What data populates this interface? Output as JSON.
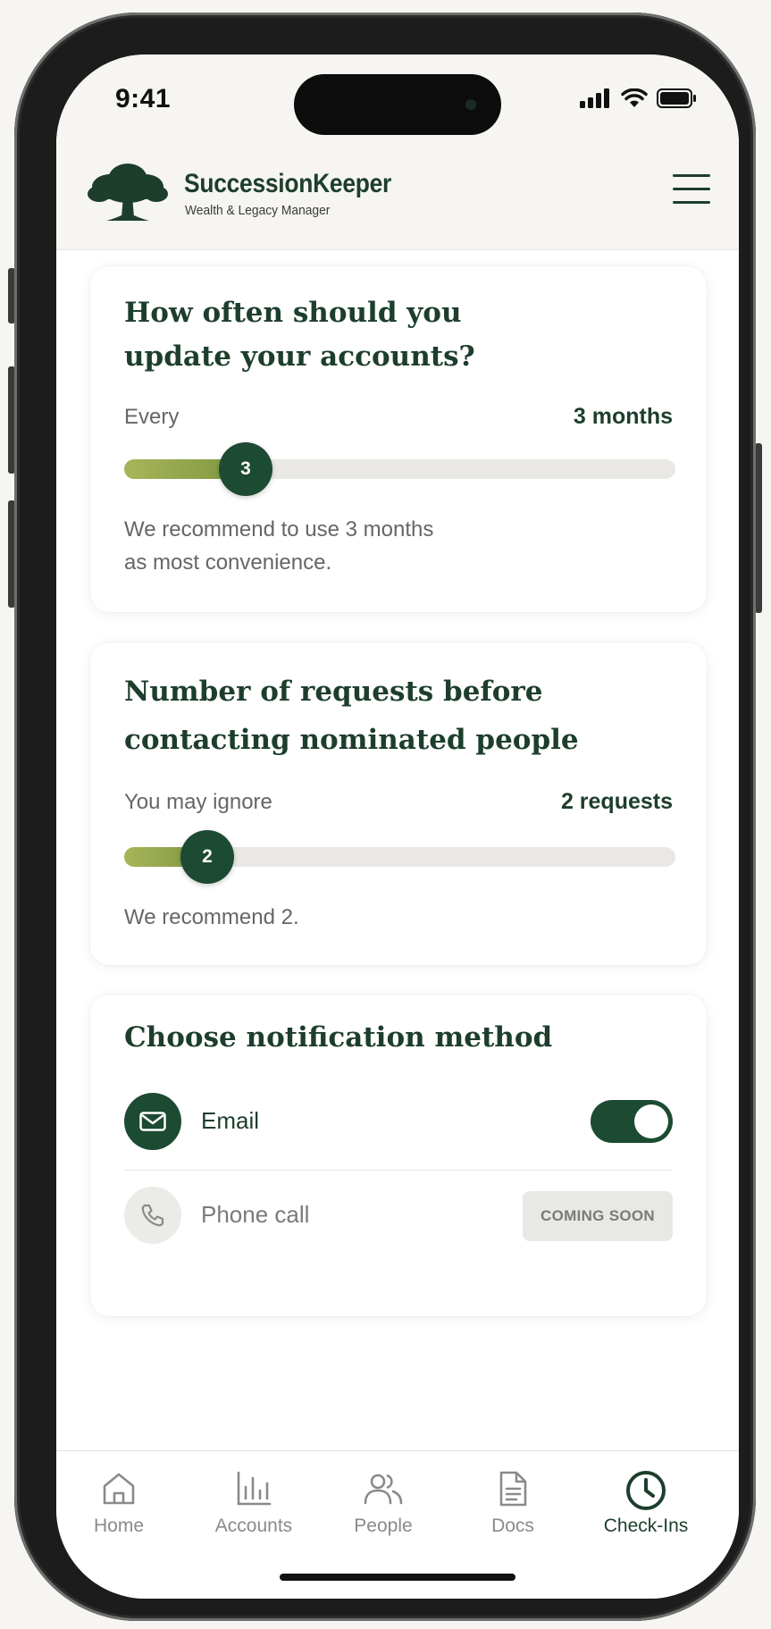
{
  "status_bar": {
    "time": "9:41"
  },
  "header": {
    "brand_name": "SuccessionKeeper",
    "tagline": "Wealth & Legacy Manager",
    "logo_icon": "oak-tree-icon",
    "menu_icon": "hamburger-menu-icon"
  },
  "update_frequency": {
    "title_line1": "How often should you",
    "title_line2": "update your accounts?",
    "label": "Every",
    "value_text": "3 months",
    "slider_value": "3",
    "slider_fraction": 0.22,
    "hint_line1": "We recommend to use 3 months",
    "hint_line2": "as most convenience."
  },
  "request_count": {
    "title_line1": "Number of requests before",
    "title_line2": "contacting nominated people",
    "label": "You may ignore",
    "value_text": "2 requests",
    "slider_value": "2",
    "slider_fraction": 0.15,
    "hint": "We recommend 2."
  },
  "notification": {
    "title": "Choose notification method",
    "options": [
      {
        "label": "Email",
        "icon": "mail-icon",
        "enabled": true
      },
      {
        "label": "Phone call",
        "icon": "phone-icon",
        "badge": "COMING SOON"
      }
    ]
  },
  "tabs": [
    {
      "label": "Home",
      "icon": "home-icon",
      "active": false
    },
    {
      "label": "Accounts",
      "icon": "bar-chart-icon",
      "active": false
    },
    {
      "label": "People",
      "icon": "people-icon",
      "active": false
    },
    {
      "label": "Docs",
      "icon": "document-icon",
      "active": false
    },
    {
      "label": "Check-Ins",
      "icon": "clock-icon",
      "active": true
    }
  ],
  "colors": {
    "primary": "#1d3e2c",
    "accent_green": "#1d4a32",
    "slider_fill": "#8fa24a",
    "background": "#f6f5f1"
  }
}
